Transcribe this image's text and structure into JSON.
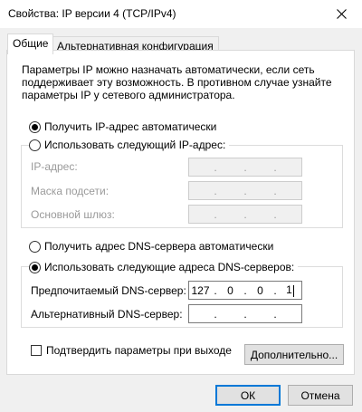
{
  "window": {
    "title": "Свойства: IP версии 4 (TCP/IPv4)",
    "close_icon": "close-icon"
  },
  "tabs": [
    {
      "label": "Общие",
      "active": true
    },
    {
      "label": "Альтернативная конфигурация",
      "active": false
    }
  ],
  "description": [
    "Параметры IP можно назначать автоматически, если сеть",
    "поддерживает эту возможность. В противном случае узнайте",
    "параметры IP у сетевого администратора."
  ],
  "ip_section": {
    "auto_label": "Получить IP-адрес автоматически",
    "auto_checked": true,
    "manual_label": "Использовать следующий IP-адрес:",
    "manual_checked": false,
    "fields": [
      {
        "label": "IP-адрес:",
        "value": [
          "",
          "",
          "",
          ""
        ],
        "disabled": true
      },
      {
        "label": "Маска подсети:",
        "value": [
          "",
          "",
          "",
          ""
        ],
        "disabled": true
      },
      {
        "label": "Основной шлюз:",
        "value": [
          "",
          "",
          "",
          ""
        ],
        "disabled": true
      }
    ]
  },
  "dns_section": {
    "auto_label": "Получить адрес DNS-сервера автоматически",
    "auto_checked": false,
    "manual_label": "Использовать следующие адреса DNS-серверов:",
    "manual_checked": true,
    "fields": [
      {
        "label": "Предпочитаемый DNS-сервер:",
        "value": [
          "127",
          "0",
          "0",
          "1"
        ],
        "disabled": false
      },
      {
        "label": "Альтернативный DNS-сервер:",
        "value": [
          "",
          "",
          "",
          ""
        ],
        "disabled": false
      }
    ]
  },
  "validate": {
    "label": "Подтвердить параметры при выходе",
    "checked": false
  },
  "buttons": {
    "advanced": "Дополнительно...",
    "ok": "ОК",
    "cancel": "Отмена"
  },
  "colors": {
    "accent": "#0078d7",
    "panel": "#ffffff",
    "client": "#f0f0f0"
  }
}
